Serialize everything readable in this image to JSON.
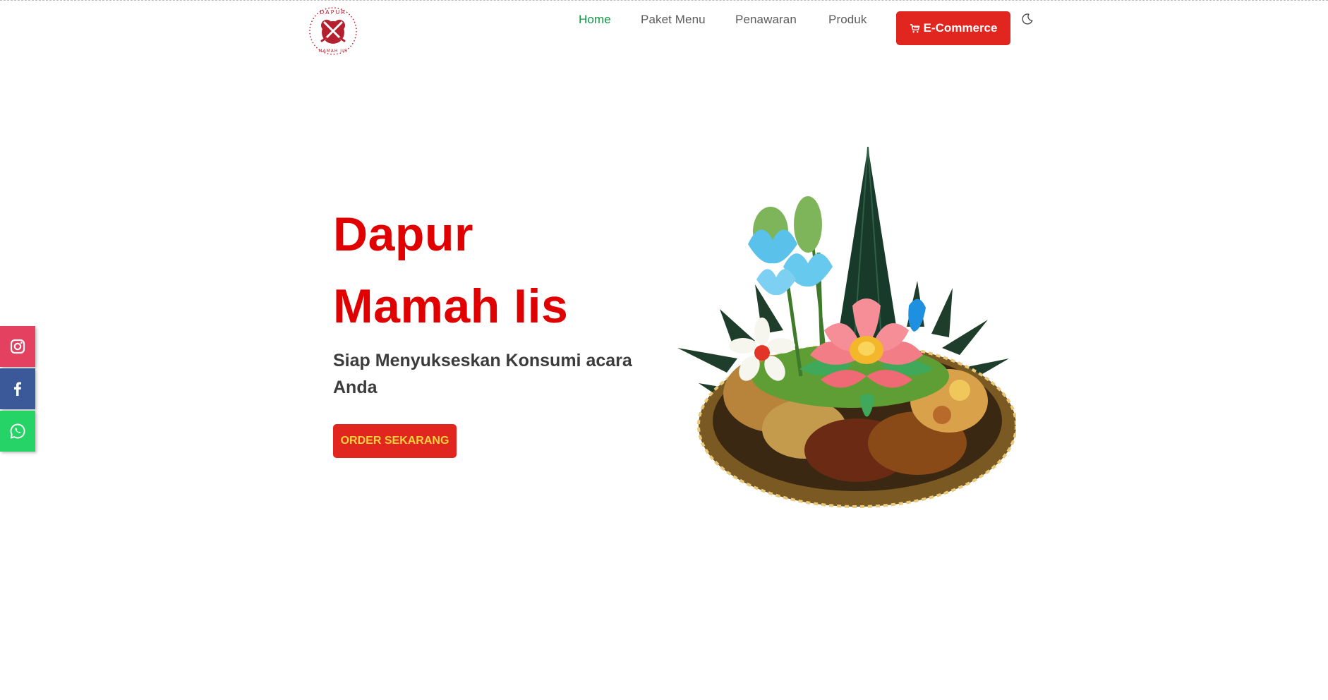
{
  "colors": {
    "brand_red": "#e0261e",
    "hero_title_red": "#e00000",
    "nav_active_green": "#119b45",
    "order_text_yellow": "#f7d33c",
    "instagram": "#e4405f",
    "facebook": "#3b5998",
    "whatsapp": "#25d366"
  },
  "header": {
    "logo_top_text": "DAPUR",
    "logo_bottom_text": "MAMAH IIS",
    "nav": {
      "home": "Home",
      "paket_menu": "Paket Menu",
      "penawaran": "Penawaran",
      "produk": "Produk"
    },
    "ecommerce_label": "E-Commerce",
    "ecommerce_icon": "cart-icon",
    "theme_toggle_icon": "moon-icon"
  },
  "social": {
    "instagram_icon": "instagram-icon",
    "facebook_icon": "facebook-icon",
    "whatsapp_icon": "whatsapp-icon"
  },
  "hero": {
    "title_line1": "Dapur",
    "title_line2": "Mamah Iis",
    "subtitle": "Siap Menyukseskan Konsumi acara Anda",
    "order_button": "ORDER SEKARANG"
  }
}
